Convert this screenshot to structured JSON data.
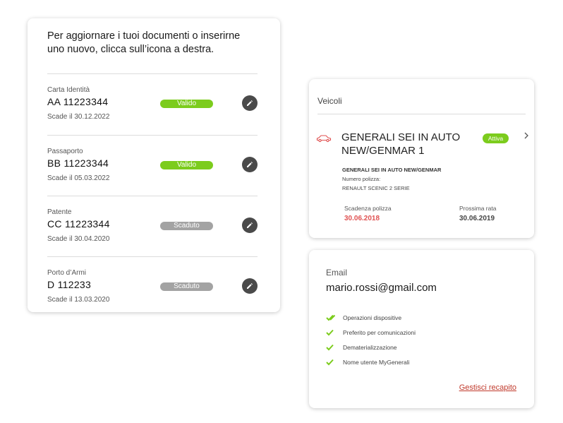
{
  "documents": {
    "intro": "Per aggiornare i tuoi documenti o inserirne uno nuovo, clicca sull’icona a destra.",
    "items": [
      {
        "type": "Carta Identità",
        "number": "AA 11223344",
        "expiry": "Scade il 30.12.2022",
        "status": "Valido",
        "status_kind": "valid"
      },
      {
        "type": "Passaporto",
        "number": "BB 11223344",
        "expiry": "Scade il 05.03.2022",
        "status": "Valido",
        "status_kind": "valid"
      },
      {
        "type": "Patente",
        "number": "CC 11223344",
        "expiry": "Scade il 30.04.2020",
        "status": "Scaduto",
        "status_kind": "expired"
      },
      {
        "type": "Porto d’Armi",
        "number": "D 112233",
        "expiry": "Scade il 13.03.2020",
        "status": "Scaduto",
        "status_kind": "expired"
      }
    ],
    "edit_icon": "pencil-icon"
  },
  "vehicles": {
    "title": "Veicoli",
    "vehicle_name": "GENERALI SEI IN AUTO NEW/GENMAR 1",
    "badge": "Attiva",
    "detail_product": "GENERALI SEI IN AUTO NEW/GENMAR",
    "detail_policy_label": "Numero polizza:",
    "detail_car": "RENAULT SCENIC 2 SERIE",
    "expiry_label": "Scadenza polizza",
    "expiry_value": "30.06.2018",
    "next_label": "Prossima rata",
    "next_value": "30.06.2019",
    "icons": [
      "car-icon",
      "chevron-right-icon"
    ]
  },
  "email": {
    "label": "Email",
    "value": "mario.rossi@gmail.com",
    "checks": [
      {
        "label": "Operazioni dispositive",
        "icon": "double-check-icon"
      },
      {
        "label": "Preferito per comunicazioni",
        "icon": "check-icon"
      },
      {
        "label": "Dematerializzazione",
        "icon": "check-icon"
      },
      {
        "label": "Nome utente MyGenerali",
        "icon": "check-icon"
      }
    ],
    "manage_link": "Gestisci recapito"
  },
  "colors": {
    "valid": "#7ccc1d",
    "expired": "#a3a3a3",
    "alert_red": "#e05252",
    "link_red": "#c0392b",
    "edit_button": "#4a4a4a"
  }
}
